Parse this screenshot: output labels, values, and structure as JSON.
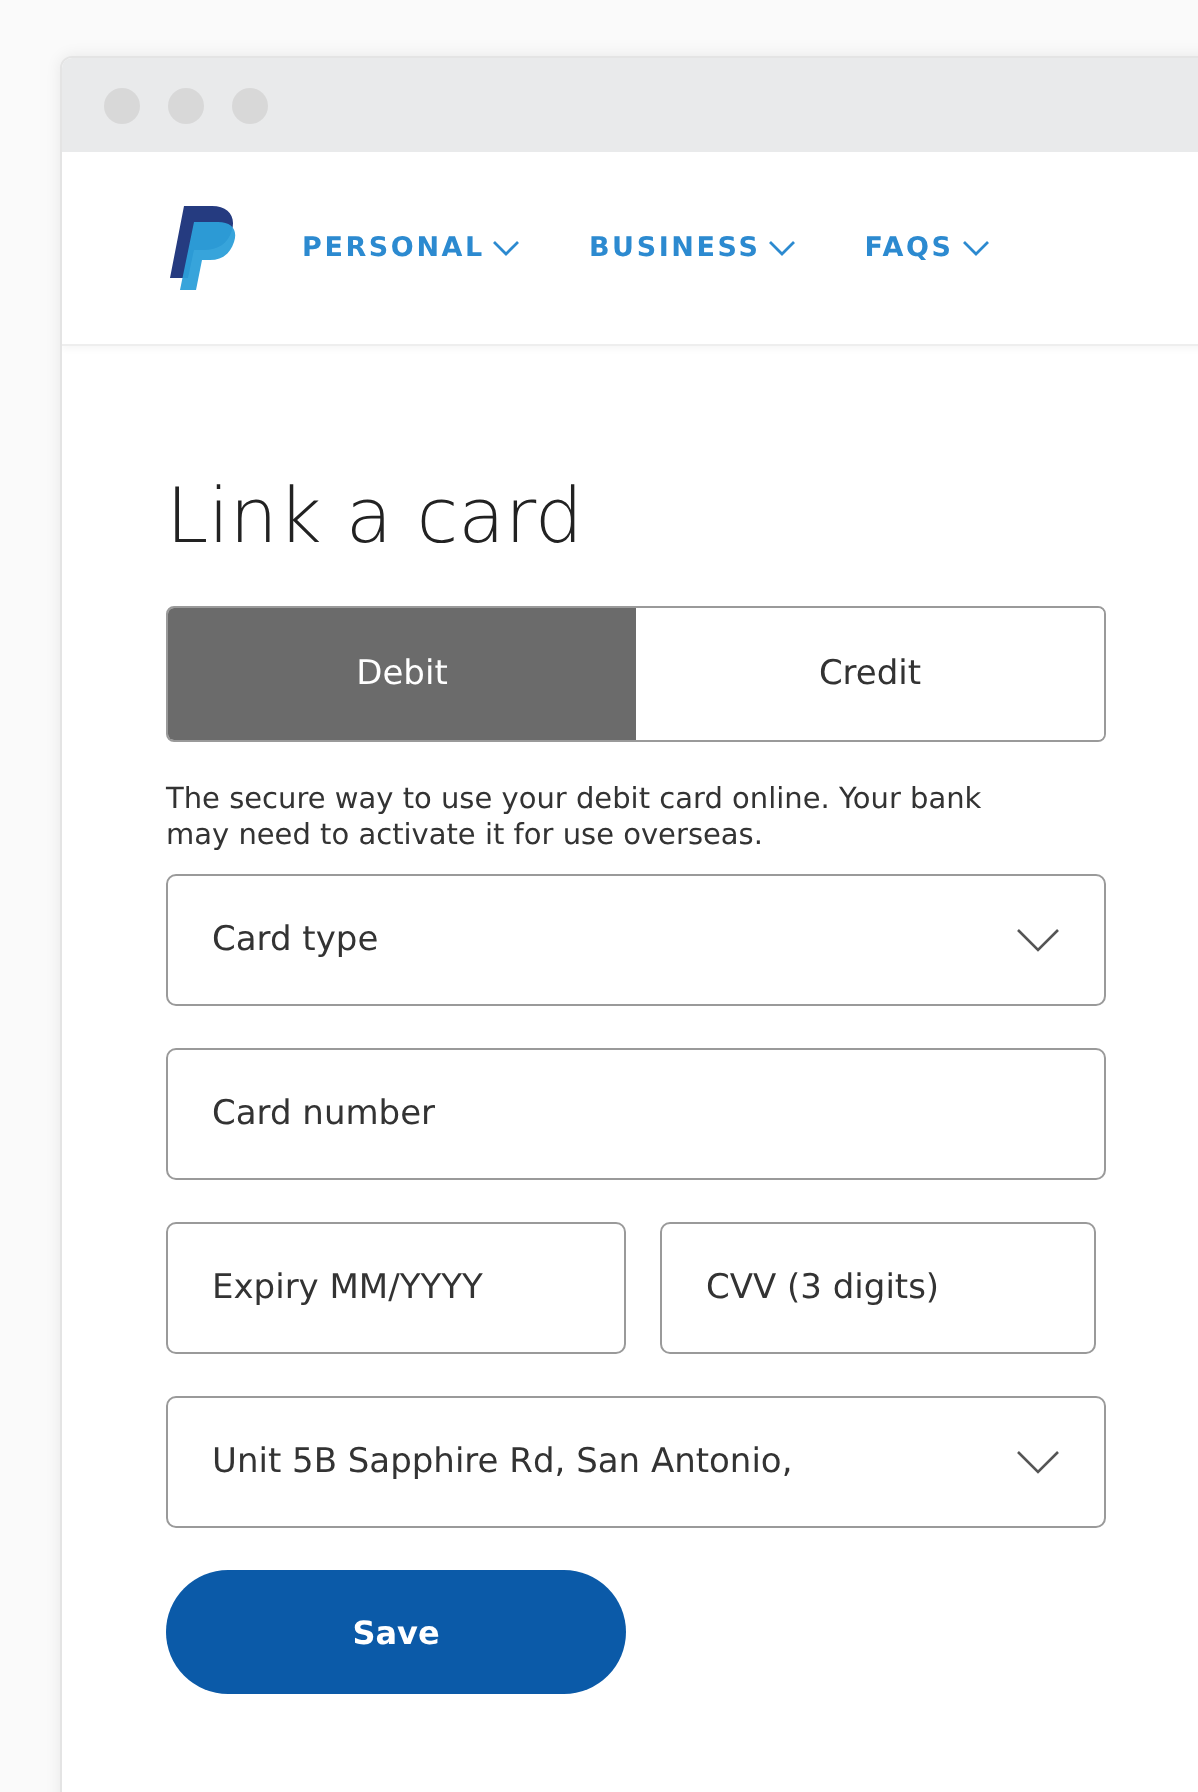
{
  "nav": {
    "items": [
      {
        "label": "PERSONAL"
      },
      {
        "label": "BUSINESS"
      },
      {
        "label": "FAQS"
      }
    ]
  },
  "heading": "Link a card",
  "card_tabs": [
    {
      "label": "Debit",
      "selected": true
    },
    {
      "label": "Credit",
      "selected": false
    }
  ],
  "description": "The secure way to use your debit card online. Your bank may need to activate it for use overseas.",
  "field_rows": [
    [
      {
        "kind": "select",
        "placeholder": "Card type"
      }
    ],
    [
      {
        "kind": "input",
        "placeholder": "Card number"
      }
    ],
    [
      {
        "kind": "input",
        "placeholder": "Expiry MM/YYYY"
      },
      {
        "kind": "input",
        "placeholder": "CVV (3 digits)"
      }
    ],
    [
      {
        "kind": "select",
        "value": "Unit 5B Sapphire Rd, San Antonio,"
      }
    ]
  ],
  "save_button": "Save"
}
